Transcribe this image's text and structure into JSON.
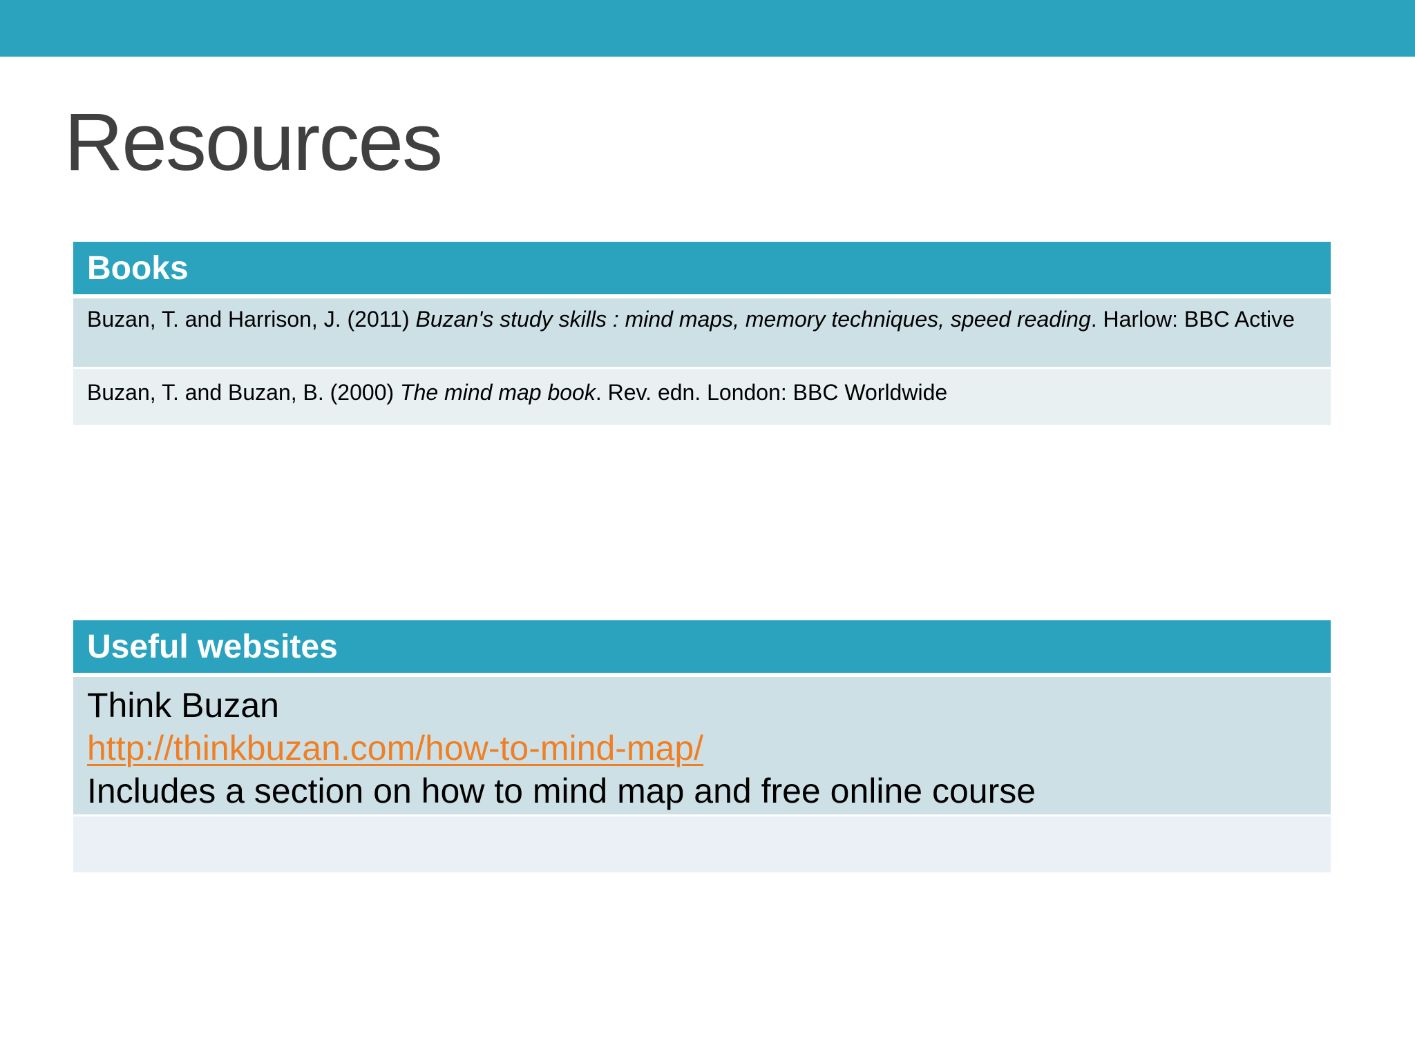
{
  "theme": {
    "accent": "#2ba3bf",
    "row_dark": "#cde0e6",
    "row_light": "#e8f0f2",
    "link_color": "#f07f24",
    "title_color": "#404040"
  },
  "slide": {
    "title": "Resources"
  },
  "books": {
    "header": "Books",
    "rows": [
      {
        "prefix": "Buzan, T. and Harrison, J. (2011) ",
        "title": "Buzan's study skills : mind maps, memory techniques, speed reading",
        "suffix": ". Harlow: BBC Active"
      },
      {
        "prefix": "Buzan, T. and Buzan, B. (2000) ",
        "title": "The mind map book",
        "suffix": ". Rev. edn. London: BBC Worldwide"
      }
    ]
  },
  "websites": {
    "header": "Useful websites",
    "rows": [
      {
        "name": "Think Buzan",
        "url": "http://thinkbuzan.com/how-to-mind-map/",
        "description": "Includes a section on how to mind map and free online course"
      }
    ]
  }
}
